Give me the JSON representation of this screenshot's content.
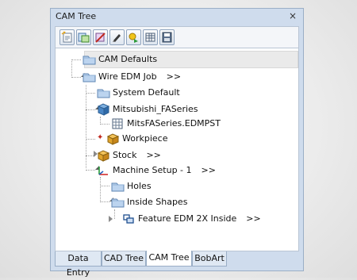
{
  "panel": {
    "title": "CAM Tree",
    "close_glyph": "×"
  },
  "toolbar": {
    "buttons": [
      {
        "name": "new-defaults-icon"
      },
      {
        "name": "add-setup-icon"
      },
      {
        "name": "delete-icon"
      },
      {
        "name": "edit-icon"
      },
      {
        "name": "generate-icon"
      },
      {
        "name": "grid-icon"
      },
      {
        "name": "save-icon"
      }
    ]
  },
  "tree": {
    "nodes": [
      {
        "label": "CAM Defaults",
        "icon": "folder-icon"
      },
      {
        "label": "Wire EDM Job",
        "more": ">>",
        "icon": "folder-icon"
      },
      {
        "label": "System Default",
        "icon": "folder-icon"
      },
      {
        "label": "Mitsubishi_FASeries",
        "icon": "machine-icon"
      },
      {
        "label": "MitsFASeries.EDMPST",
        "icon": "post-file-icon"
      },
      {
        "label": "Workpiece",
        "icon": "workpiece-icon"
      },
      {
        "label": "Stock",
        "more": ">>",
        "icon": "stock-icon"
      },
      {
        "label": "Machine Setup - 1",
        "more": ">>",
        "icon": "axes-icon"
      },
      {
        "label": "Holes",
        "icon": "folder-icon"
      },
      {
        "label": "Inside Shapes",
        "icon": "folder-icon"
      },
      {
        "label": "Feature EDM 2X Inside",
        "more": ">>",
        "icon": "feature-icon"
      }
    ]
  },
  "tabs": [
    {
      "label": "Data Entry"
    },
    {
      "label": "CAD Tree"
    },
    {
      "label": "CAM Tree",
      "active": true
    },
    {
      "label": "BobArt"
    }
  ]
}
